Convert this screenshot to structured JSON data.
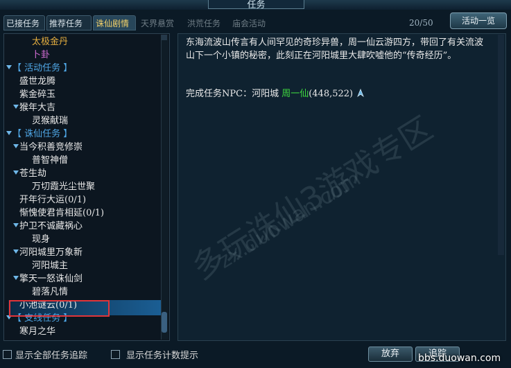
{
  "window": {
    "title": "任务"
  },
  "tabs": [
    {
      "label": "已接任务",
      "state": "normal"
    },
    {
      "label": "推荐任务",
      "state": "normal"
    },
    {
      "label": "诛仙剧情",
      "state": "active"
    },
    {
      "label": "天界悬赏",
      "state": "disabled"
    },
    {
      "label": "洪荒任务",
      "state": "disabled"
    },
    {
      "label": "庙会活动",
      "state": "disabled"
    }
  ],
  "counter": "20/50",
  "activity_button": "活动一览",
  "tree": [
    {
      "label": "太极金丹",
      "color": "#e8b040",
      "indent": 2,
      "arrow": false
    },
    {
      "label": "卜卦",
      "color": "#d66fd8",
      "indent": 2,
      "arrow": false
    },
    {
      "label": "【 活动任务 】",
      "color": "#4fa7e6",
      "indent": 0,
      "arrow": true
    },
    {
      "label": "盛世龙腾",
      "color": "#e8e8e8",
      "indent": 1,
      "arrow": false
    },
    {
      "label": "紫金碎玉",
      "color": "#e8e8e8",
      "indent": 1,
      "arrow": false
    },
    {
      "label": "猴年大吉",
      "color": "#e8e8e8",
      "indent": 1,
      "arrow": true
    },
    {
      "label": "灵猴献瑞",
      "color": "#e8e8e8",
      "indent": 2,
      "arrow": false
    },
    {
      "label": "【 诛仙任务 】",
      "color": "#4fa7e6",
      "indent": 0,
      "arrow": true
    },
    {
      "label": "当今积善竞修崇",
      "color": "#e8e8e8",
      "indent": 1,
      "arrow": true
    },
    {
      "label": "普智神僧",
      "color": "#e8e8e8",
      "indent": 2,
      "arrow": false
    },
    {
      "label": "苍生劫",
      "color": "#e8e8e8",
      "indent": 1,
      "arrow": true
    },
    {
      "label": "万切霞光尘世聚",
      "color": "#e8e8e8",
      "indent": 2,
      "arrow": false
    },
    {
      "label": "开年行大运(0/1)",
      "color": "#e8e8e8",
      "indent": 1,
      "arrow": false
    },
    {
      "label": "惭愧使君肯相延(0/1)",
      "color": "#e8e8e8",
      "indent": 1,
      "arrow": false
    },
    {
      "label": "护卫不诚藏祸心",
      "color": "#e8e8e8",
      "indent": 1,
      "arrow": true
    },
    {
      "label": "现身",
      "color": "#e8e8e8",
      "indent": 2,
      "arrow": false
    },
    {
      "label": "河阳城里万象新",
      "color": "#e8e8e8",
      "indent": 1,
      "arrow": true
    },
    {
      "label": "河阳城主",
      "color": "#e8e8e8",
      "indent": 2,
      "arrow": false
    },
    {
      "label": "擎天一怒诛仙剑",
      "color": "#e8e8e8",
      "indent": 1,
      "arrow": true
    },
    {
      "label": "碧落凡情",
      "color": "#e8e8e8",
      "indent": 2,
      "arrow": false
    },
    {
      "label": "小池谜云(0/1)",
      "color": "#e8e8e8",
      "indent": 1,
      "arrow": false,
      "selected": true
    },
    {
      "label": "【 支线任务 】",
      "color": "#4fa7e6",
      "indent": 0,
      "arrow": true
    },
    {
      "label": "寒月之华",
      "color": "#e8e8e8",
      "indent": 1,
      "arrow": false
    }
  ],
  "detail": {
    "description": "东海流波山传言有人间罕见的奇珍异兽，周一仙云游四方，带回了有关流波山下一个小镇的秘密，此刻正在河阳城里大肆吹嘘他的“传奇经历”。",
    "npc_prefix": "完成任务NPC：河阳城 ",
    "npc_name": "周一仙",
    "npc_coord": "(448,522)"
  },
  "bottom": {
    "show_all_track": "显示全部任务追踪",
    "show_count": "显示任务计数提示",
    "abandon": "放弃",
    "track": "追踪"
  },
  "watermark": {
    "line1": "多玩诛仙3游戏专区",
    "line2": "zx.duowan.com"
  },
  "site": "bbs.duowan.com"
}
